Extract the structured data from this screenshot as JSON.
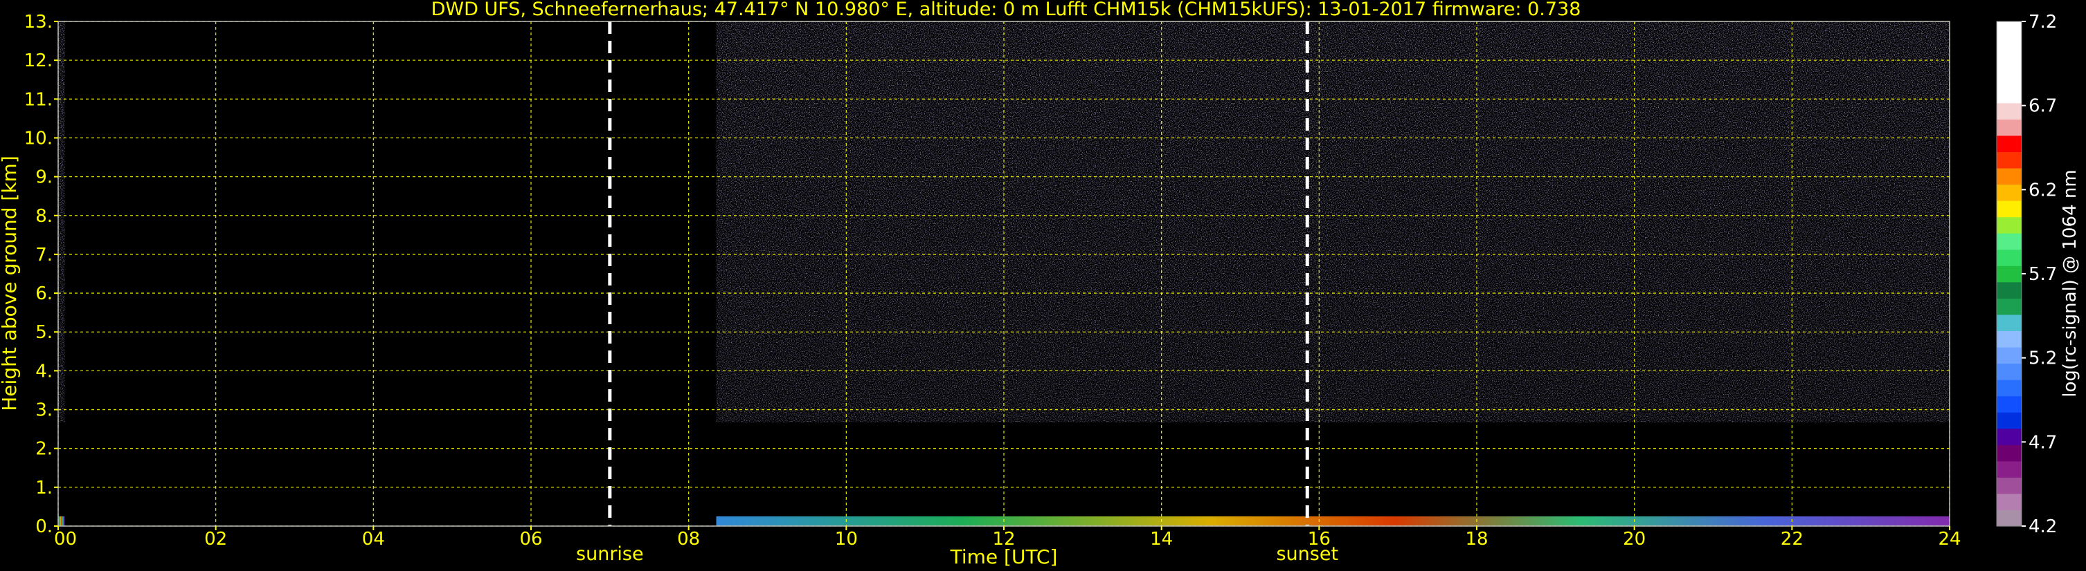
{
  "chart_data": {
    "type": "heatmap",
    "title": "DWD UFS, Schneefernerhaus; 47.417° N 10.980° E, altitude: 0 m    Lufft CHM15k (CHM15kUFS): 13-01-2017    firmware: 0.738",
    "xlabel": "Time [UTC]",
    "ylabel": "Height above ground [km]",
    "xlim": [
      0,
      24
    ],
    "ylim": [
      0,
      13
    ],
    "x_ticks": [
      "00",
      "02",
      "04",
      "06",
      "08",
      "10",
      "12",
      "14",
      "16",
      "18",
      "20",
      "22",
      "24"
    ],
    "y_ticks": [
      "0.",
      "1.",
      "2.",
      "3.",
      "4.",
      "5.",
      "6.",
      "7.",
      "8.",
      "9.",
      "10.",
      "11.",
      "12.",
      "13."
    ],
    "grid": true,
    "annotations": [
      {
        "label": "sunrise",
        "x": 7.0
      },
      {
        "label": "sunset",
        "x": 15.85
      }
    ],
    "data_coverage": [
      {
        "start": 0.0,
        "end": 0.08
      },
      {
        "start": 8.35,
        "end": 24.0
      }
    ],
    "colorbar": {
      "label": "log(rc-signal) @ 1064 nm",
      "ticks": [
        "4.2",
        "4.7",
        "5.2",
        "5.7",
        "6.2",
        "6.7",
        "7.2"
      ],
      "range": [
        4.2,
        7.2
      ]
    }
  },
  "colors": {
    "axis_text": "#ffff00",
    "grid": "#ffff00",
    "background": "#000000",
    "colorbar_text": "#ffffff"
  }
}
